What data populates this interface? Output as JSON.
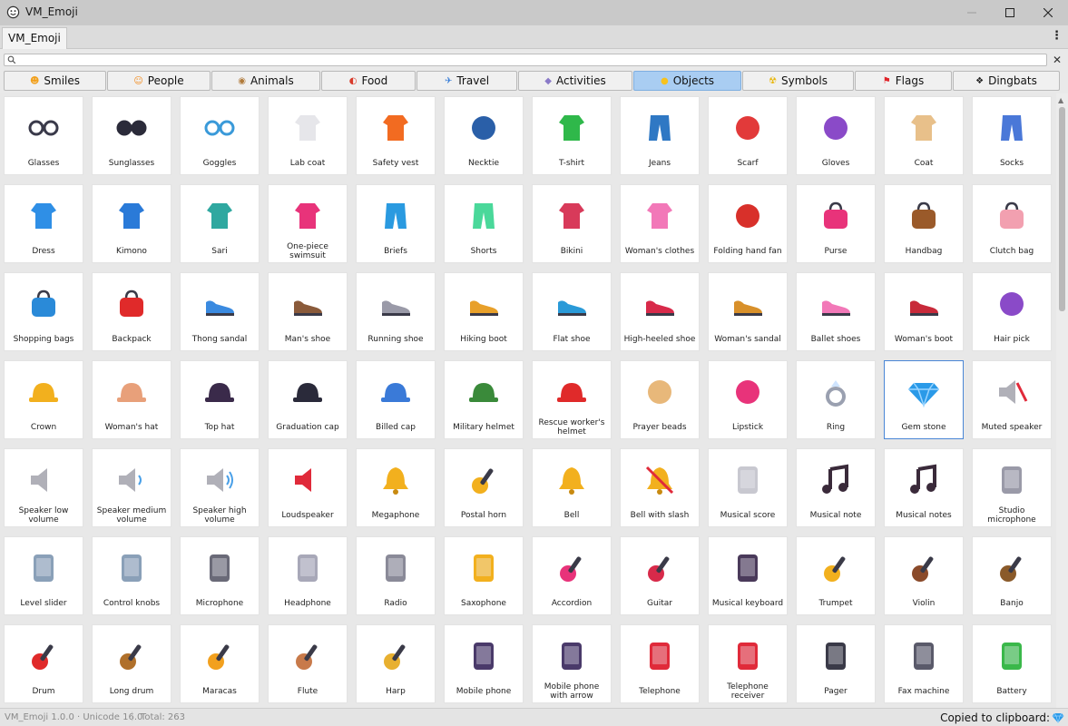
{
  "window": {
    "title": "VM_Emoji"
  },
  "tab": {
    "label": "VM_Emoji"
  },
  "search": {
    "placeholder": "",
    "value": ""
  },
  "categories": [
    {
      "label": "Smiles",
      "icon": "smiling-face-icon",
      "glyph": "☻",
      "color": "#f2a01b"
    },
    {
      "label": "People",
      "icon": "person-icon",
      "glyph": "☺",
      "color": "#f28a1b"
    },
    {
      "label": "Animals",
      "icon": "dog-icon",
      "glyph": "◉",
      "color": "#b07a3a"
    },
    {
      "label": "Food",
      "icon": "watermelon-icon",
      "glyph": "◐",
      "color": "#d83a2a"
    },
    {
      "label": "Travel",
      "icon": "airplane-icon",
      "glyph": "✈",
      "color": "#3a7fd8"
    },
    {
      "label": "Activities",
      "icon": "dice-icon",
      "glyph": "◆",
      "color": "#8a7ac8"
    },
    {
      "label": "Objects",
      "icon": "light-bulb-icon",
      "glyph": "●",
      "color": "#f7c21e"
    },
    {
      "label": "Symbols",
      "icon": "radioactive-icon",
      "glyph": "☢",
      "color": "#e8b400"
    },
    {
      "label": "Flags",
      "icon": "red-flag-icon",
      "glyph": "⚑",
      "color": "#e0242a"
    },
    {
      "label": "Dingbats",
      "icon": "four-diamonds-icon",
      "glyph": "❖",
      "color": "#222222"
    }
  ],
  "active_category": "Objects",
  "emojis": [
    {
      "label": "Glasses",
      "icon": "glasses-icon",
      "color": "#3a3a4a"
    },
    {
      "label": "Sunglasses",
      "icon": "sunglasses-icon",
      "color": "#2b2b3a"
    },
    {
      "label": "Goggles",
      "icon": "goggles-icon",
      "color": "#3a9ad9"
    },
    {
      "label": "Lab coat",
      "icon": "lab-coat-icon",
      "color": "#e6e6ea"
    },
    {
      "label": "Safety vest",
      "icon": "safety-vest-icon",
      "color": "#f26b21"
    },
    {
      "label": "Necktie",
      "icon": "necktie-icon",
      "color": "#2a5fa8"
    },
    {
      "label": "T-shirt",
      "icon": "t-shirt-icon",
      "color": "#2fb84a"
    },
    {
      "label": "Jeans",
      "icon": "jeans-icon",
      "color": "#2f78c4"
    },
    {
      "label": "Scarf",
      "icon": "scarf-icon",
      "color": "#e23a3a"
    },
    {
      "label": "Gloves",
      "icon": "gloves-icon",
      "color": "#8a4ac8"
    },
    {
      "label": "Coat",
      "icon": "coat-icon",
      "color": "#e8c08a"
    },
    {
      "label": "Socks",
      "icon": "socks-icon",
      "color": "#4a78d8"
    },
    {
      "label": "Dress",
      "icon": "dress-icon",
      "color": "#2f8fe6"
    },
    {
      "label": "Kimono",
      "icon": "kimono-icon",
      "color": "#2a7ad8"
    },
    {
      "label": "Sari",
      "icon": "sari-icon",
      "color": "#2fa8a0"
    },
    {
      "label": "One-piece swimsuit",
      "icon": "swimsuit-icon",
      "color": "#e8337a"
    },
    {
      "label": "Briefs",
      "icon": "briefs-icon",
      "color": "#2a9ae0"
    },
    {
      "label": "Shorts",
      "icon": "shorts-icon",
      "color": "#4ad89a"
    },
    {
      "label": "Bikini",
      "icon": "bikini-icon",
      "color": "#d83a5a"
    },
    {
      "label": "Woman's clothes",
      "icon": "womans-clothes-icon",
      "color": "#f278b8"
    },
    {
      "label": "Folding hand fan",
      "icon": "folding-fan-icon",
      "color": "#d8302a"
    },
    {
      "label": "Purse",
      "icon": "purse-icon",
      "color": "#e8337a"
    },
    {
      "label": "Handbag",
      "icon": "handbag-icon",
      "color": "#9a5a2a"
    },
    {
      "label": "Clutch bag",
      "icon": "clutch-bag-icon",
      "color": "#f2a0b0"
    },
    {
      "label": "Shopping bags",
      "icon": "shopping-bags-icon",
      "color": "#2a8ad8"
    },
    {
      "label": "Backpack",
      "icon": "backpack-icon",
      "color": "#e02a2a"
    },
    {
      "label": "Thong sandal",
      "icon": "thong-sandal-icon",
      "color": "#3a8ae0"
    },
    {
      "label": "Man's shoe",
      "icon": "mans-shoe-icon",
      "color": "#8a5a3a"
    },
    {
      "label": "Running shoe",
      "icon": "running-shoe-icon",
      "color": "#9a9aa8"
    },
    {
      "label": "Hiking boot",
      "icon": "hiking-boot-icon",
      "color": "#e8a02a"
    },
    {
      "label": "Flat shoe",
      "icon": "flat-shoe-icon",
      "color": "#2a9ad8"
    },
    {
      "label": "High-heeled shoe",
      "icon": "high-heeled-shoe-icon",
      "color": "#d82a4a"
    },
    {
      "label": "Woman's sandal",
      "icon": "womans-sandal-icon",
      "color": "#d8902a"
    },
    {
      "label": "Ballet shoes",
      "icon": "ballet-shoes-icon",
      "color": "#f278b8"
    },
    {
      "label": "Woman's boot",
      "icon": "womans-boot-icon",
      "color": "#c82a3a"
    },
    {
      "label": "Hair pick",
      "icon": "hair-pick-icon",
      "color": "#8a4ac8"
    },
    {
      "label": "Crown",
      "icon": "crown-icon",
      "color": "#f2b01e"
    },
    {
      "label": "Woman's hat",
      "icon": "womans-hat-icon",
      "color": "#e8a07a"
    },
    {
      "label": "Top hat",
      "icon": "top-hat-icon",
      "color": "#3a2a4a"
    },
    {
      "label": "Graduation cap",
      "icon": "graduation-cap-icon",
      "color": "#2a2a3a"
    },
    {
      "label": "Billed cap",
      "icon": "billed-cap-icon",
      "color": "#3a7ad8"
    },
    {
      "label": "Military helmet",
      "icon": "military-helmet-icon",
      "color": "#3a8a3a"
    },
    {
      "label": "Rescue worker's helmet",
      "icon": "rescue-helmet-icon",
      "color": "#e02a2a"
    },
    {
      "label": "Prayer beads",
      "icon": "prayer-beads-icon",
      "color": "#e8b87a"
    },
    {
      "label": "Lipstick",
      "icon": "lipstick-icon",
      "color": "#e8337a"
    },
    {
      "label": "Ring",
      "icon": "ring-icon",
      "color": "#9aa0b0"
    },
    {
      "label": "Gem stone",
      "icon": "gem-stone-icon",
      "color": "#2a9ae8"
    },
    {
      "label": "Muted speaker",
      "icon": "muted-speaker-icon",
      "color": "#b0b0b8"
    },
    {
      "label": "Speaker low volume",
      "icon": "speaker-low-icon",
      "color": "#b0b0b8"
    },
    {
      "label": "Speaker medium volume",
      "icon": "speaker-medium-icon",
      "color": "#b0b0b8"
    },
    {
      "label": "Speaker high volume",
      "icon": "speaker-high-icon",
      "color": "#b0b0b8"
    },
    {
      "label": "Loudspeaker",
      "icon": "loudspeaker-icon",
      "color": "#e02a3a"
    },
    {
      "label": "Megaphone",
      "icon": "megaphone-icon",
      "color": "#f2b01e"
    },
    {
      "label": "Postal horn",
      "icon": "postal-horn-icon",
      "color": "#f2b01e"
    },
    {
      "label": "Bell",
      "icon": "bell-icon",
      "color": "#f2b01e"
    },
    {
      "label": "Bell with slash",
      "icon": "bell-slash-icon",
      "color": "#f2b01e"
    },
    {
      "label": "Musical score",
      "icon": "musical-score-icon",
      "color": "#c8c8d0"
    },
    {
      "label": "Musical note",
      "icon": "musical-note-icon",
      "color": "#3a2a3a"
    },
    {
      "label": "Musical notes",
      "icon": "musical-notes-icon",
      "color": "#3a2a3a"
    },
    {
      "label": "Studio microphone",
      "icon": "studio-microphone-icon",
      "color": "#9a9aa8"
    },
    {
      "label": "Level slider",
      "icon": "level-slider-icon",
      "color": "#8aa0b8"
    },
    {
      "label": "Control knobs",
      "icon": "control-knobs-icon",
      "color": "#8aa0b8"
    },
    {
      "label": "Microphone",
      "icon": "microphone-icon",
      "color": "#6a6a78"
    },
    {
      "label": "Headphone",
      "icon": "headphone-icon",
      "color": "#a8a8b8"
    },
    {
      "label": "Radio",
      "icon": "radio-icon",
      "color": "#8a8a98"
    },
    {
      "label": "Saxophone",
      "icon": "saxophone-icon",
      "color": "#f2b01e"
    },
    {
      "label": "Accordion",
      "icon": "accordion-icon",
      "color": "#e8337a"
    },
    {
      "label": "Guitar",
      "icon": "guitar-icon",
      "color": "#d82a4a"
    },
    {
      "label": "Musical keyboard",
      "icon": "musical-keyboard-icon",
      "color": "#4a3a5a"
    },
    {
      "label": "Trumpet",
      "icon": "trumpet-icon",
      "color": "#f2b01e"
    },
    {
      "label": "Violin",
      "icon": "violin-icon",
      "color": "#8a4a2a"
    },
    {
      "label": "Banjo",
      "icon": "banjo-icon",
      "color": "#8a5a2a"
    },
    {
      "label": "Drum",
      "icon": "drum-icon",
      "color": "#e02a2a"
    },
    {
      "label": "Long drum",
      "icon": "long-drum-icon",
      "color": "#b0702a"
    },
    {
      "label": "Maracas",
      "icon": "maracas-icon",
      "color": "#f2a01e"
    },
    {
      "label": "Flute",
      "icon": "flute-icon",
      "color": "#c87a4a"
    },
    {
      "label": "Harp",
      "icon": "harp-icon",
      "color": "#e8b030"
    },
    {
      "label": "Mobile phone",
      "icon": "mobile-phone-icon",
      "color": "#4a3a6a"
    },
    {
      "label": "Mobile phone with arrow",
      "icon": "mobile-phone-arrow-icon",
      "color": "#4a3a6a"
    },
    {
      "label": "Telephone",
      "icon": "telephone-icon",
      "color": "#e02a3a"
    },
    {
      "label": "Telephone receiver",
      "icon": "telephone-receiver-icon",
      "color": "#e02a3a"
    },
    {
      "label": "Pager",
      "icon": "pager-icon",
      "color": "#3a3a48"
    },
    {
      "label": "Fax machine",
      "icon": "fax-machine-icon",
      "color": "#5a5a6a"
    },
    {
      "label": "Battery",
      "icon": "battery-icon",
      "color": "#3ab84a"
    }
  ],
  "selected_emoji": "Gem stone",
  "status": {
    "version": "VM_Emoji 1.0.0 · Unicode 16.0",
    "separator": "|",
    "total": "Total: 263",
    "copied": "Copied to clipboard:",
    "copied_emoji_icon": "gem-stone-icon"
  }
}
